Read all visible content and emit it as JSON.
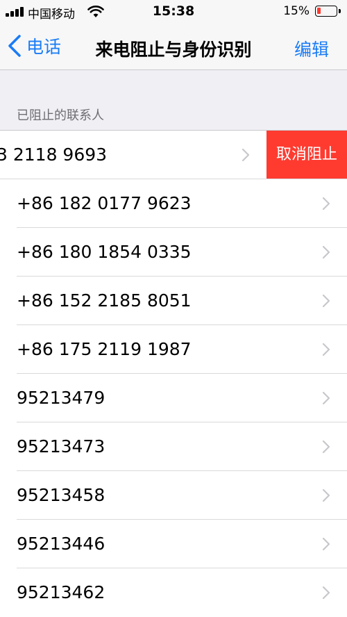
{
  "status_bar": {
    "carrier": "中国移动",
    "time": "15:38",
    "battery": "15%",
    "battery_level": 0.15
  },
  "nav": {
    "back_label": "电话",
    "title": "来电阻止与身份识别",
    "edit_label": "编辑"
  },
  "section_header": "已阻止的联系人",
  "rows": [
    {
      "number": "3 2118 9693",
      "action": "取消阻止"
    },
    {
      "number": "+86 182 0177 9623"
    },
    {
      "number": "+86 180 1854 0335"
    },
    {
      "number": "+86 152 2185 8051"
    },
    {
      "number": "+86 175 2119 1987"
    },
    {
      "number": "95213479"
    },
    {
      "number": "95213473"
    },
    {
      "number": "95213458"
    },
    {
      "number": "95213446"
    },
    {
      "number": "95213462"
    }
  ],
  "colors": {
    "accent": "#1a7cf5",
    "destructive": "#ff3b30",
    "background": "#efeff4"
  }
}
